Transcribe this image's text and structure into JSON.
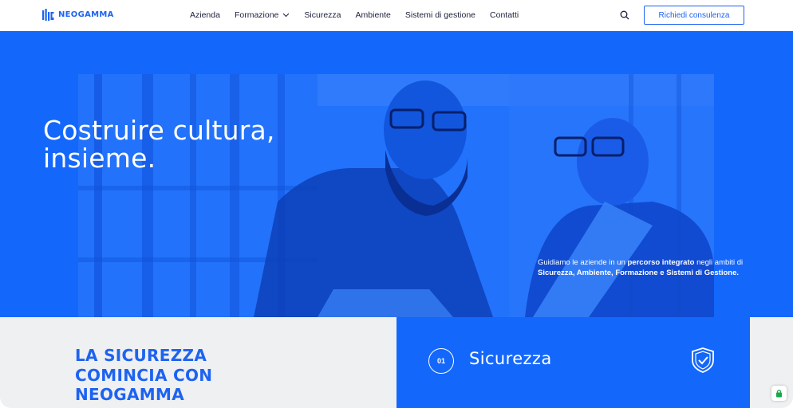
{
  "brand": {
    "name": "NEOGAMMA",
    "accent": "#1d63f2",
    "hero_bg": "#1467fb"
  },
  "nav": {
    "items": [
      {
        "label": "Azienda"
      },
      {
        "label": "Formazione",
        "has_dropdown": true
      },
      {
        "label": "Sicurezza"
      },
      {
        "label": "Ambiente"
      },
      {
        "label": "Sistemi di gestione"
      },
      {
        "label": "Contatti"
      }
    ],
    "search_icon": "search-icon",
    "cta_label": "Richiedi consulenza"
  },
  "hero": {
    "title_line1": "Costruire cultura,",
    "title_line2": "insieme.",
    "desc_pre": "Guidiamo le aziende in un ",
    "desc_bold1": "percorso integrato",
    "desc_mid": " negli ambiti di ",
    "desc_bold2": "Sicurezza, Ambiente, Formazione e Sistemi di Gestione."
  },
  "section": {
    "title_line1": "LA SICUREZZA",
    "title_line2": "COMINCIA CON",
    "title_line3": "NEOGAMMA"
  },
  "card": {
    "number": "01",
    "title": "Sicurezza",
    "icon": "shield-check-icon"
  },
  "cookie": {
    "icon": "cookie-settings-icon"
  }
}
